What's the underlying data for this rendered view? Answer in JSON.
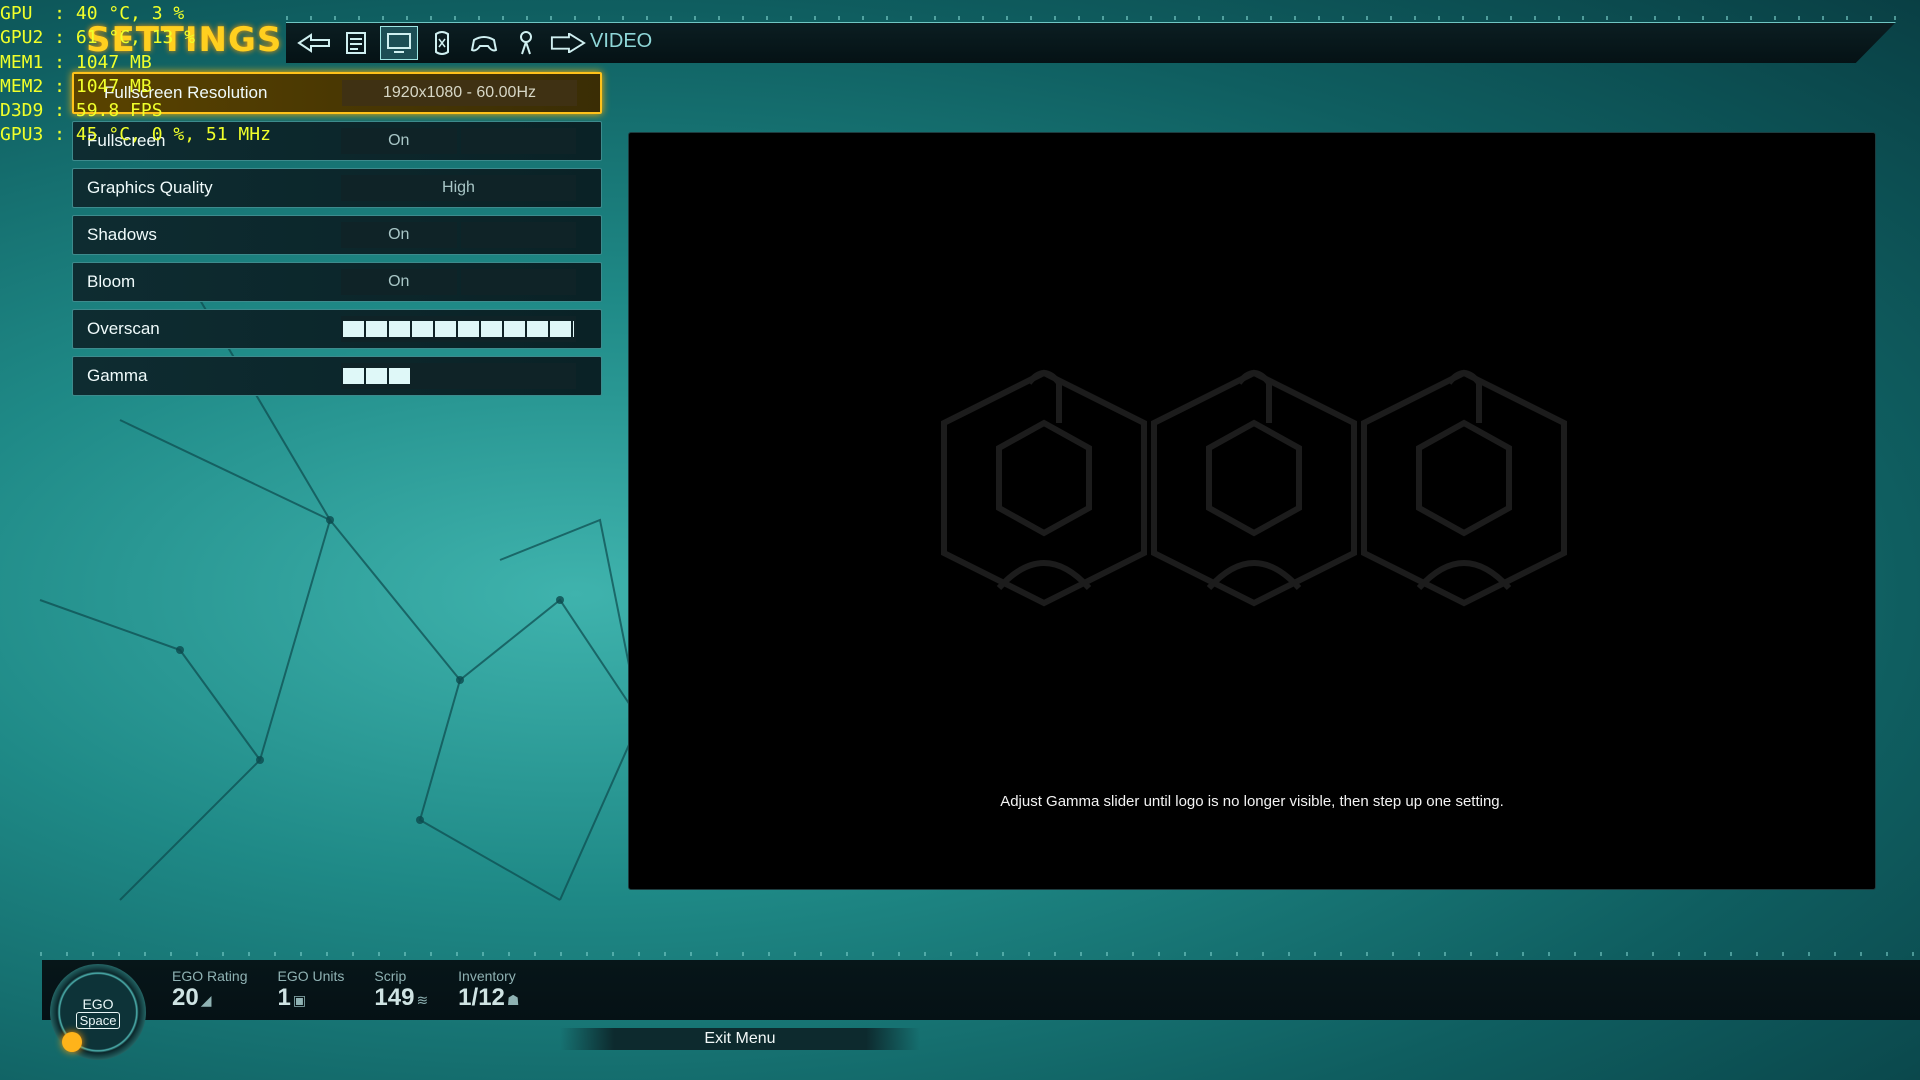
{
  "header": {
    "title": "SETTINGS",
    "section": "VIDEO",
    "tabs": [
      {
        "name": "back-arrow-icon"
      },
      {
        "name": "general-tab-icon"
      },
      {
        "name": "video-tab-icon",
        "active": true
      },
      {
        "name": "audio-tab-icon"
      },
      {
        "name": "controller-tab-icon"
      },
      {
        "name": "keys-tab-icon"
      },
      {
        "name": "forward-arrow-icon"
      }
    ]
  },
  "settings": [
    {
      "label": "Fullscreen Resolution",
      "type": "value",
      "value": "1920x1080 - 60.00Hz",
      "selected": true
    },
    {
      "label": "Fullscreen",
      "type": "toggle",
      "value": "On"
    },
    {
      "label": "Graphics Quality",
      "type": "value",
      "value": "High"
    },
    {
      "label": "Shadows",
      "type": "toggle",
      "value": "On"
    },
    {
      "label": "Bloom",
      "type": "toggle",
      "value": "On"
    },
    {
      "label": "Overscan",
      "type": "slider",
      "level": 1.0
    },
    {
      "label": "Gamma",
      "type": "slider",
      "level": 0.3
    }
  ],
  "preview": {
    "hint": "Adjust Gamma slider until logo is no longer visible, then step up one setting."
  },
  "overlay": {
    "lines": [
      "GPU  : 40 °C, 3 %",
      "GPU2 : 61 °C, 13 %",
      "MEM1 : 1047 MB",
      "MEM2 : 1047 MB",
      "D3D9 : 59.8 FPS",
      "GPU3 : 45 °C, 0 %, 51 MHz"
    ],
    "color": "#f0ff2a"
  },
  "footer": {
    "badge_top": "EGO",
    "badge_bottom": "Space",
    "stats": [
      {
        "label": "EGO Rating",
        "value": "20"
      },
      {
        "label": "EGO Units",
        "value": "1"
      },
      {
        "label": "Scrip",
        "value": "149"
      },
      {
        "label": "Inventory",
        "value": "1/12"
      }
    ],
    "exit_label": "Exit Menu"
  },
  "colors": {
    "accent": "#ffc21a",
    "title": "#ffcf1f",
    "panel": "#0e2c31"
  }
}
